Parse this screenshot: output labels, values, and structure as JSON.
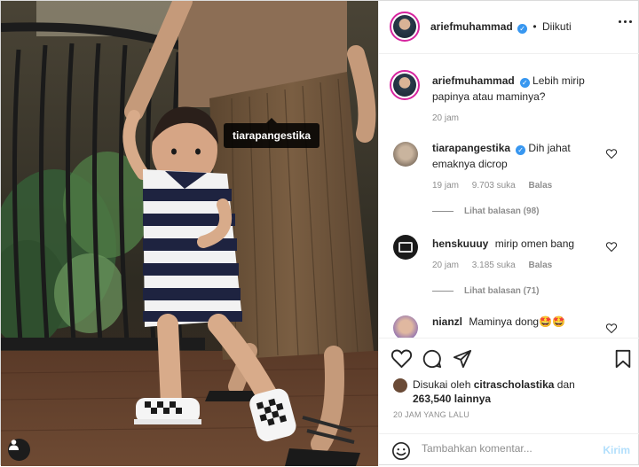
{
  "colors": {
    "accent": "#3897f0",
    "muted": "#8e8e8e",
    "post_disabled": "#b2dffc",
    "text": "#262626"
  },
  "photo": {
    "tag_label": "tiarapangestika"
  },
  "header": {
    "username": "ariefmuhammad",
    "separator": "•",
    "follow_status": "Diikuti"
  },
  "caption": {
    "username": "ariefmuhammad",
    "text": "Lebih mirip papinya atau maminya?",
    "time": "20 jam"
  },
  "comments": [
    {
      "username": "tiarapangestika",
      "verified": true,
      "text": "Dih jahat emaknya dicrop",
      "time": "19 jam",
      "likes": "9.703 suka",
      "reply": "Balas",
      "view_replies": "Lihat balasan (98)"
    },
    {
      "username": "henskuuuy",
      "text": "mirip omen bang",
      "time": "20 jam",
      "likes": "3.185 suka",
      "reply": "Balas",
      "view_replies": "Lihat balasan (71)"
    },
    {
      "username": "nianzl",
      "text": "Maminya dong🤩🤩"
    }
  ],
  "likes": {
    "prefix": "Disukai oleh",
    "user": "citrascholastika",
    "conj": "dan",
    "count": "263,540",
    "suffix": "lainnya"
  },
  "timestamp": "20 JAM YANG LALU",
  "comment_box": {
    "placeholder": "Tambahkan komentar...",
    "send_label": "Kirim"
  },
  "icons": [
    "more-icon",
    "heart-icon",
    "comment-icon",
    "share-icon",
    "bookmark-icon",
    "emoji-icon",
    "user-tag-icon",
    "verified-icon"
  ]
}
